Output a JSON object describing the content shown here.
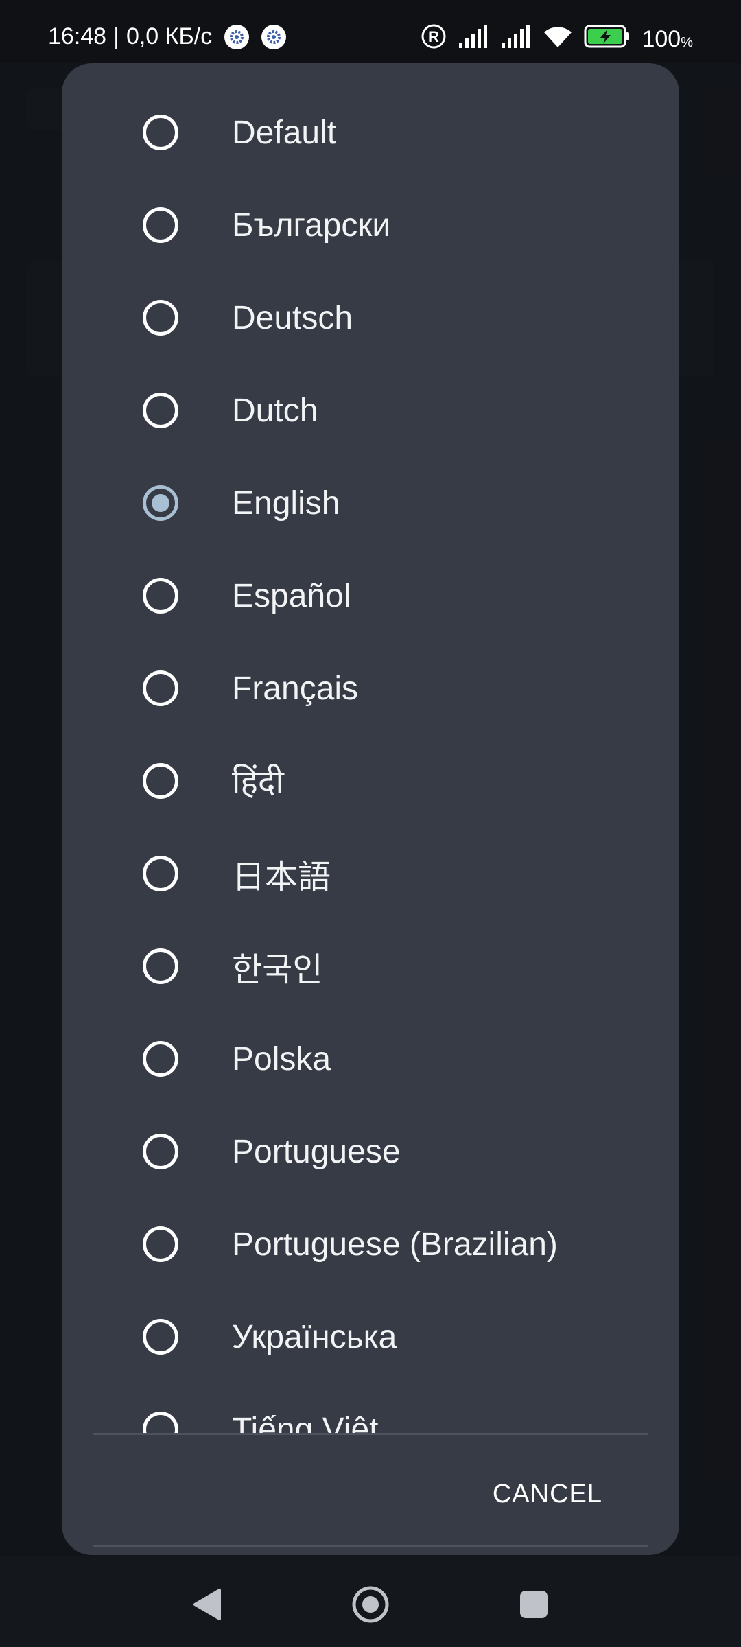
{
  "status_bar": {
    "time": "16:48",
    "separator": "|",
    "network_speed": "0,0 КБ/с",
    "battery_percent": "100",
    "battery_percent_sign": "%",
    "icons": [
      "settings-notification-icon",
      "settings-notification-icon",
      "registered-icon",
      "signal-icon",
      "signal-icon",
      "wifi-icon",
      "battery-charging-icon"
    ]
  },
  "dialog": {
    "options": [
      {
        "label": "Default",
        "selected": false
      },
      {
        "label": "Български",
        "selected": false
      },
      {
        "label": "Deutsch",
        "selected": false
      },
      {
        "label": "Dutch",
        "selected": false
      },
      {
        "label": "English",
        "selected": true
      },
      {
        "label": "Español",
        "selected": false
      },
      {
        "label": "Français",
        "selected": false
      },
      {
        "label": "हिंदी",
        "selected": false
      },
      {
        "label": "日本語",
        "selected": false
      },
      {
        "label": "한국인",
        "selected": false
      },
      {
        "label": "Polska",
        "selected": false
      },
      {
        "label": "Portuguese",
        "selected": false
      },
      {
        "label": "Portuguese (Brazilian)",
        "selected": false
      },
      {
        "label": "Українська",
        "selected": false
      },
      {
        "label": "Tiếng Việt",
        "selected": false
      }
    ],
    "cancel_label": "CANCEL"
  },
  "nav_bar": {
    "icons": [
      "back-icon",
      "home-icon",
      "recents-icon"
    ]
  },
  "colors": {
    "dialog_bg": "#363b46",
    "radio_selected": "#a9bfd3",
    "text": "#f2f3f5"
  }
}
